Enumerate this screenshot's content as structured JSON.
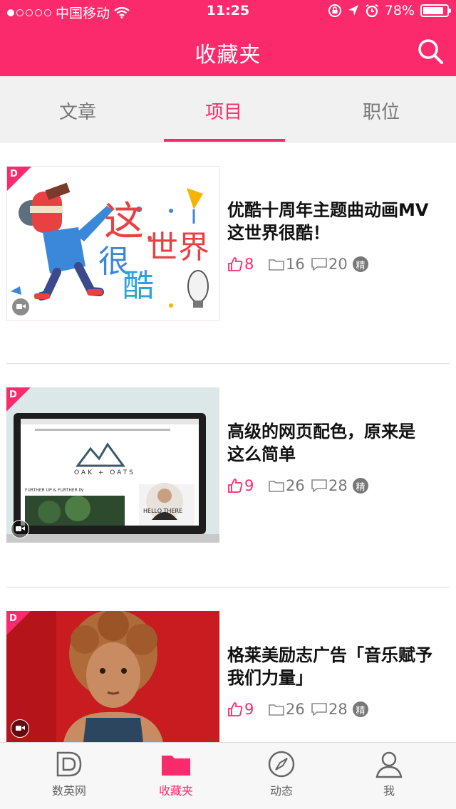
{
  "status_bar": {
    "carrier": "中国移动",
    "time": "11:25",
    "battery": "78%",
    "battery_level": 0.78
  },
  "header": {
    "title": "收藏夹",
    "search_icon": "search-icon",
    "color": "#fb2a6c"
  },
  "tabs": [
    {
      "label": "文章",
      "active": false
    },
    {
      "label": "项目",
      "active": true
    },
    {
      "label": "职位",
      "active": false
    }
  ],
  "items": [
    {
      "title_line1": "优酷十周年主题曲动画MV",
      "title_line2": "这世界很酷！",
      "likes": "8",
      "folders": "16",
      "comments": "20",
      "badge": "精",
      "thumb_text": [
        "这",
        "世界",
        "很",
        "酷"
      ]
    },
    {
      "title_line1": "高级的网页配色，原来是",
      "title_line2": "这么简单",
      "likes": "9",
      "folders": "26",
      "comments": "28",
      "badge": "精",
      "thumb_text": [
        "OAK + OATS",
        "FURTHER UP & FURTHER IN",
        "HELLO THERE"
      ]
    },
    {
      "title_line1": "格莱美励志广告「音乐赋予",
      "title_line2": "我们力量」",
      "likes": "9",
      "folders": "26",
      "comments": "28",
      "badge": "精"
    }
  ],
  "bottom_nav": [
    {
      "label": "数英网",
      "icon": "d-logo-icon",
      "active": false
    },
    {
      "label": "收藏夹",
      "icon": "folder-icon",
      "active": true
    },
    {
      "label": "动态",
      "icon": "compass-icon",
      "active": false
    },
    {
      "label": "我",
      "icon": "user-icon",
      "active": false
    }
  ]
}
